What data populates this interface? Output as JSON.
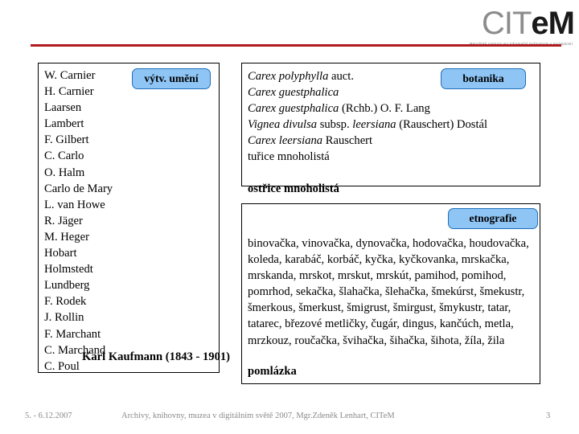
{
  "header": {
    "logo_main_light": "CIT",
    "logo_main_dark": "eM",
    "logo_subtitle": "Metodické centrum pro informační technologie v muzejnictví",
    "rule_color": "#b01b20"
  },
  "badges": {
    "art": "výtv. umění",
    "botany": "botanika",
    "ethnography": "etnografie",
    "fill_color": "#8ec5f5",
    "border_color": "#1f6fba"
  },
  "left_panel": {
    "names": [
      "W. Carnier",
      "H. Carnier",
      "Laarsen",
      "Lambert",
      "F. Gilbert",
      "C. Carlo",
      "O. Halm",
      "Carlo de Mary",
      "L. van Howe",
      "R. Jäger",
      "M. Heger",
      "Hobart",
      "Holmstedt",
      "Lundberg",
      "F. Rodek",
      "J. Rollin",
      "F. Marchant",
      "C. Marchand",
      "C. Poul"
    ],
    "caption": "Karl Kaufmann (1843 - 1901)"
  },
  "botany_panel": {
    "lines": [
      {
        "italic": "Carex polyphylla",
        "roman": " auct."
      },
      {
        "italic": "Carex guestphalica",
        "roman": ""
      },
      {
        "italic": "Carex guestphalica",
        "roman": " (Rchb.) O. F. Lang"
      },
      {
        "italic": "Vignea divulsa",
        "roman": " subsp. ",
        "italic2": "leersiana",
        "roman2": " (Rauschert) Dostál"
      },
      {
        "italic": "Carex leersiana",
        "roman": " Rauschert"
      },
      {
        "italic": "",
        "roman": "tuřice mnoholistá"
      }
    ],
    "term": "ostřice mnoholistá"
  },
  "ethnography_panel": {
    "words": "binovačka, vinovačka, dynovačka, hodovačka, houdovačka, koleda, karabáč, korbáč, kyčka, kyčkovanka, mrskačka, mrskanda, mrskot, mrskut, mrskút, pamihod, pomihod, pomrhod, sekačka, šlahačka, šlehačka, šmekúrst, šmekustr, šmerkous, šmerkust, šmigrust, šmirgust, šmykustr, tatar, tatarec, březové metličky, čugár, dingus, kančúch, metla, mrzkouz, roučačka, švihačka, šihačka, šihota, žíla, žila",
    "term": "pomlázka"
  },
  "footer": {
    "date": "5. - 6.12.2007",
    "center": "Archivy, knihovny, muzea v digitálním světě 2007, Mgr.Zdeněk Lenhart, CITeM",
    "page": "3"
  }
}
